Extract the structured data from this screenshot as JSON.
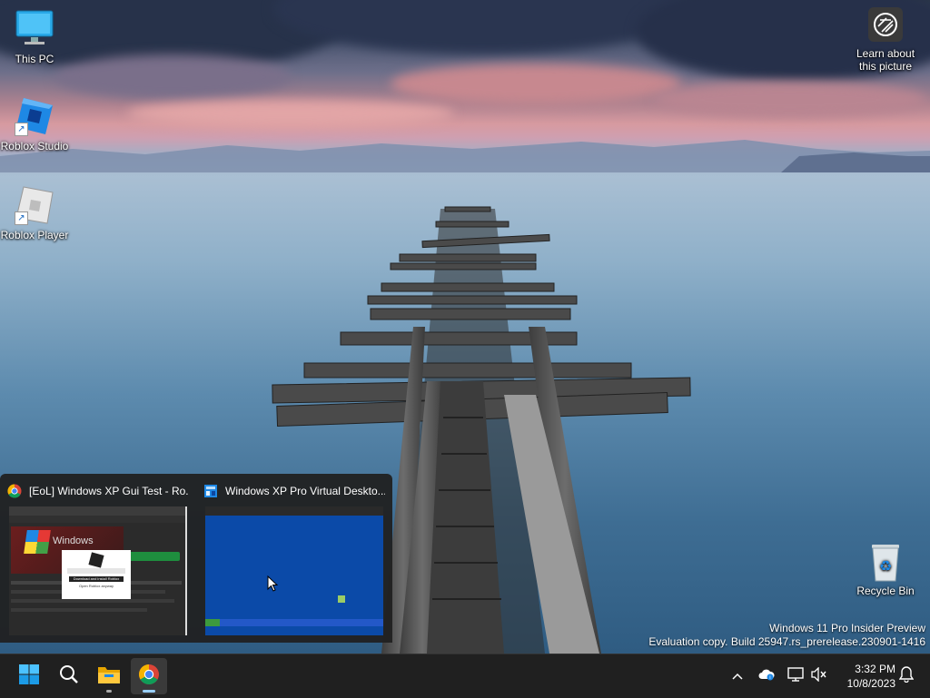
{
  "desktop": {
    "icons": [
      {
        "label": "This PC",
        "icon": "this-pc-icon"
      },
      {
        "label": "Roblox Studio",
        "icon": "roblox-studio-icon"
      },
      {
        "label": "Roblox Player",
        "icon": "roblox-player-icon"
      },
      {
        "label": "Recycle Bin",
        "icon": "recycle-bin-icon"
      }
    ],
    "learn_about": {
      "label": "Learn about this picture",
      "icon": "camera-info-icon"
    },
    "watermark": {
      "line1": "Windows 11 Pro Insider Preview",
      "line2": "Evaluation copy. Build 25947.rs_prerelease.230901-1416"
    }
  },
  "thumbnails": [
    {
      "title": "[EoL] Windows XP Gui Test - Ro...",
      "icon": "chrome-icon",
      "preview": {
        "windows_text": "Windows",
        "dialog_button": "Download and install Roblox",
        "dialog_link": "Open Roblox anyway"
      }
    },
    {
      "title": "Windows XP Pro Virtual Deskto...",
      "icon": "roblox-studio-small-icon"
    }
  ],
  "taskbar": {
    "buttons": [
      "start-icon",
      "search-icon",
      "file-explorer-icon",
      "chrome-icon"
    ],
    "tray": [
      "chevron-up-icon",
      "onedrive-icon",
      "network-icon",
      "volume-muted-icon"
    ],
    "time": "3:32 PM",
    "date": "10/8/2023",
    "notification_icon": "bell-icon"
  },
  "colors": {
    "taskbar": "#202020",
    "accent": "#0078d4"
  }
}
